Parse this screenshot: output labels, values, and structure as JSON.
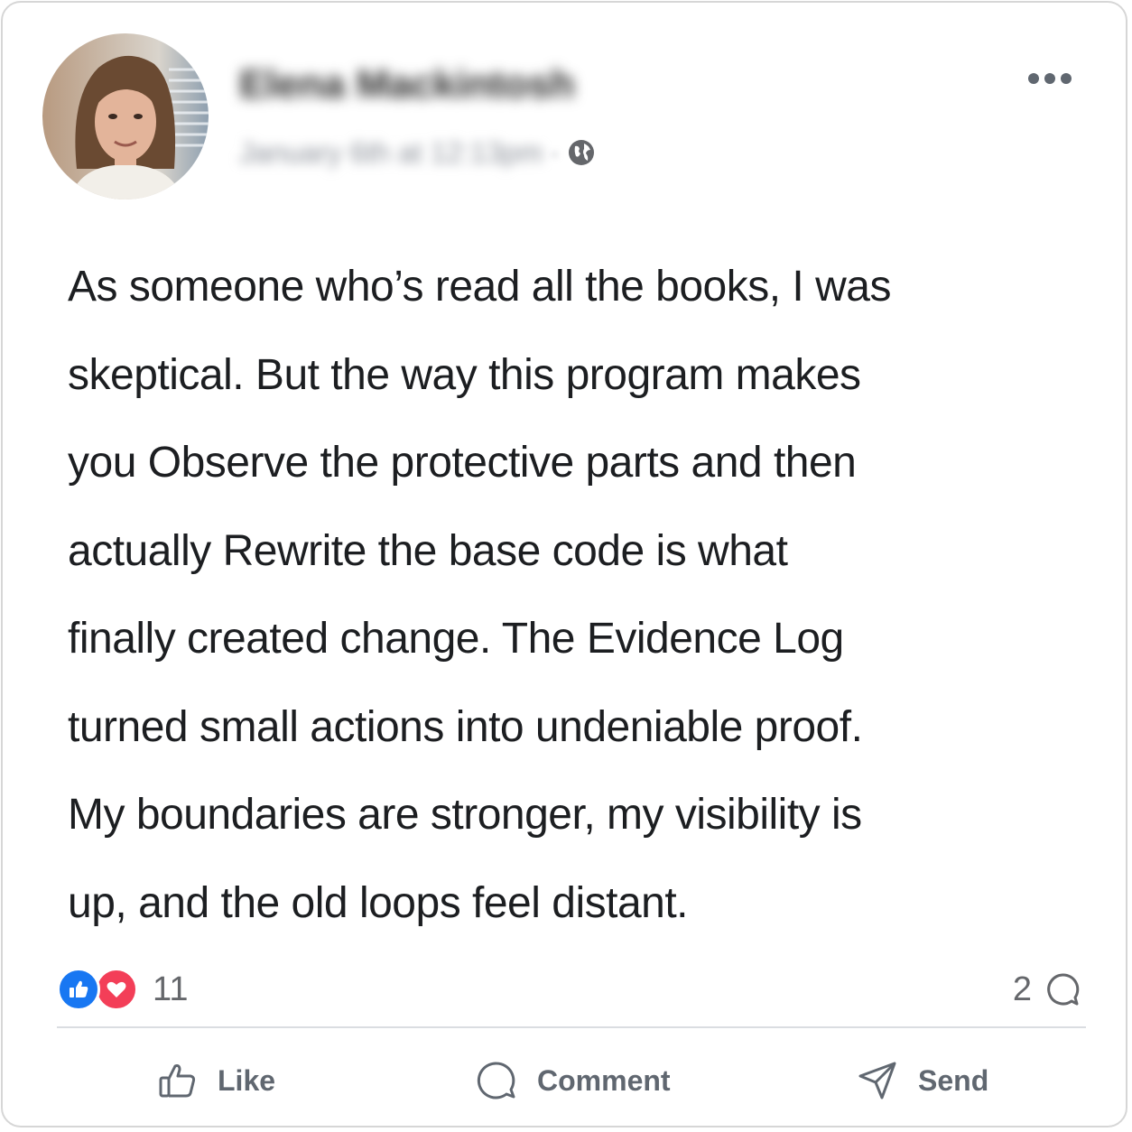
{
  "post": {
    "author": "Elena Mackintosh",
    "timestamp": "January 6th at 12:13pm",
    "separator": "·",
    "privacy_icon": "globe-icon",
    "more_icon": "more-options-icon",
    "body_lines": [
      "As someone who’s read all the books, I was",
      "skeptical. But the way this program makes",
      "you Observe the protective parts and then",
      "actually Rewrite the base code is what",
      "finally created change. The Evidence Log",
      "turned small actions into undeniable proof.",
      "My boundaries are stronger, my visibility is",
      "up, and the old loops feel distant."
    ]
  },
  "reactions": {
    "icons": [
      "like-reaction-icon",
      "love-reaction-icon"
    ],
    "count": "11"
  },
  "comments": {
    "count": "2",
    "icon": "comment-bubble-icon"
  },
  "actions": {
    "like_label": "Like",
    "comment_label": "Comment",
    "send_label": "Send"
  },
  "colors": {
    "like_blue": "#1877f2",
    "love_red": "#f33e58",
    "text": "#1c1e21",
    "muted": "#65676b"
  }
}
